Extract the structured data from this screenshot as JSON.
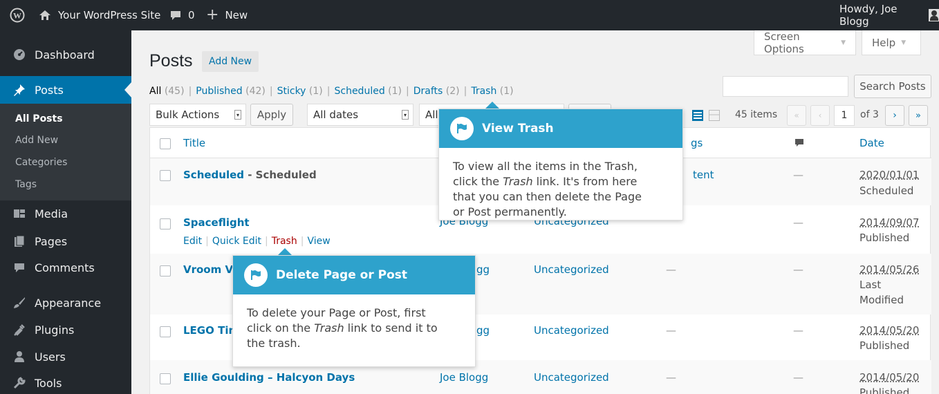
{
  "colors": {
    "admin_bg": "#23282d",
    "accent": "#0073aa",
    "callout": "#2ea2cc",
    "trash_red": "#a00"
  },
  "adminbar": {
    "site_name": "Your WordPress Site",
    "comments": "0",
    "new_label": "New",
    "howdy": "Howdy, Joe Blogg",
    "icons": [
      "wordpress-logo-icon",
      "home-icon",
      "comment-icon",
      "plus-icon",
      "avatar"
    ]
  },
  "sidebar": {
    "items": [
      {
        "label": "Dashboard",
        "icon": "dashboard-icon"
      },
      {
        "label": "Posts",
        "icon": "pin-icon",
        "current": true
      },
      {
        "label": "Media",
        "icon": "media-icon"
      },
      {
        "label": "Pages",
        "icon": "pages-icon"
      },
      {
        "label": "Comments",
        "icon": "comment-icon"
      },
      {
        "label": "Appearance",
        "icon": "brush-icon"
      },
      {
        "label": "Plugins",
        "icon": "plugin-icon"
      },
      {
        "label": "Users",
        "icon": "user-icon"
      },
      {
        "label": "Tools",
        "icon": "wrench-icon"
      }
    ],
    "submenu": [
      "All Posts",
      "Add New",
      "Categories",
      "Tags"
    ]
  },
  "header": {
    "title": "Posts",
    "add_new": "Add New",
    "screen_options": "Screen Options",
    "help": "Help",
    "dropdown_glyph": "▼"
  },
  "views": [
    {
      "label": "All",
      "count": "(45)"
    },
    {
      "label": "Published",
      "count": "(42)"
    },
    {
      "label": "Sticky",
      "count": "(1)"
    },
    {
      "label": "Scheduled",
      "count": "(1)"
    },
    {
      "label": "Drafts",
      "count": "(2)"
    },
    {
      "label": "Trash",
      "count": "(1)"
    }
  ],
  "views_separator": "|",
  "toolbar": {
    "bulk_actions": "Bulk Actions",
    "apply": "Apply",
    "dates": "All dates",
    "categories": "All",
    "search_button": "Search Posts",
    "search_value": "",
    "items_count": "45 items",
    "first_page": "«",
    "prev_page": "‹",
    "current_page": "1",
    "of_pages": "of 3",
    "next_page": "›",
    "last_page": "»"
  },
  "table": {
    "headers": {
      "title": "Title",
      "tags": "gs",
      "date": "Date"
    },
    "rows": [
      {
        "title": "Scheduled",
        "state": " - Scheduled",
        "tags": "tent",
        "comments": "—",
        "date": "2020/01/01",
        "status": "Scheduled"
      },
      {
        "title": "Spaceflight",
        "author": "Joe Blogg",
        "category": "Uncategorized",
        "tags": "—",
        "comments": "—",
        "date": "2014/09/07",
        "status": "Published",
        "actions": [
          "Edit",
          "Quick Edit",
          "Trash",
          "View"
        ],
        "action_separator": "|"
      },
      {
        "title": "Vroom Vr",
        "author": "gg",
        "category": "Uncategorized",
        "tags": "—",
        "comments": "—",
        "date": "2014/05/26",
        "status": "Last Modified",
        "status_line1": "Last",
        "status_line2": "Modified"
      },
      {
        "title": "LEGO Tim",
        "author": "gg",
        "category": "Uncategorized",
        "tags": "—",
        "comments": "—",
        "date": "2014/05/20",
        "status": "Published"
      },
      {
        "title": "Ellie Goulding – Halcyon Days",
        "author": "Joe Blogg",
        "category": "Uncategorized",
        "tags": "—",
        "comments": "—",
        "date": "2014/05/20",
        "status": "Published"
      }
    ]
  },
  "callouts": {
    "view_trash": {
      "title": "View Trash",
      "body_l1": "To view all the items in the Trash,",
      "body_l2_a": "click the ",
      "body_l2_em": "Trash",
      "body_l2_b": " link. It's from here",
      "body_l3": "that you can then delete the Page",
      "body_l4": "or Post permanently."
    },
    "delete": {
      "title": "Delete Page or Post",
      "body_l1": "To delete your Page or Post, first",
      "body_l2_a": "click on the ",
      "body_l2_em": "Trash",
      "body_l2_b": " link to send it to",
      "body_l3": "the trash."
    }
  }
}
